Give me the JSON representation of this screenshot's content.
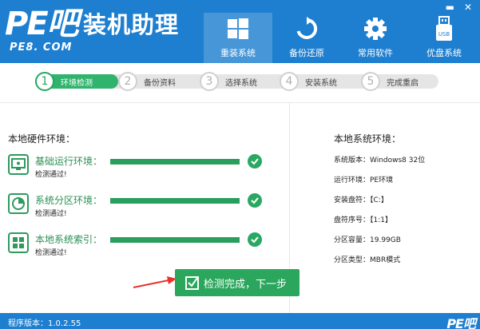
{
  "app": {
    "logo_mark": "PE吧",
    "name": "装机助理",
    "domain": "PE8. COM",
    "footer_logo": "PE吧"
  },
  "window_controls": {
    "minimize": "▬",
    "close": "✕"
  },
  "nav": {
    "items": [
      {
        "label": "重装系统",
        "icon": "windows-icon",
        "active": true
      },
      {
        "label": "备份还原",
        "icon": "refresh-icon"
      },
      {
        "label": "常用软件",
        "icon": "gear-icon"
      },
      {
        "label": "优盘系统",
        "icon": "usb-icon"
      }
    ]
  },
  "steps": [
    {
      "num": "1",
      "label": "环境检测",
      "active": true
    },
    {
      "num": "2",
      "label": "备份资料"
    },
    {
      "num": "3",
      "label": "选择系统"
    },
    {
      "num": "4",
      "label": "安装系统"
    },
    {
      "num": "5",
      "label": "完成重启"
    }
  ],
  "hardware": {
    "title": "本地硬件环境：",
    "checks": [
      {
        "name": "基础运行环境：",
        "status": "检测通过!",
        "icon": "computer-icon",
        "progress": 1.0
      },
      {
        "name": "系统分区环境：",
        "status": "检测通过!",
        "icon": "pie-chart-icon",
        "progress": 1.0
      },
      {
        "name": "本地系统索引：",
        "status": "检测通过!",
        "icon": "windows-logo-icon",
        "progress": 1.0
      }
    ]
  },
  "system": {
    "title": "本地系统环境：",
    "rows": [
      "系统版本：Windows8  32位",
      "运行环境：PE环境",
      "安装盘符：【C:】",
      "盘符序号：【1:1】",
      "分区容量：19.99GB",
      "分区类型：MBR模式"
    ]
  },
  "next_button": {
    "label": "检测完成，下一步"
  },
  "footer": {
    "version": "程序版本：1.0.2.55"
  },
  "colors": {
    "header": "#1e7fd0",
    "accent_green": "#2aa65d",
    "arrow_red": "#e8322c"
  }
}
